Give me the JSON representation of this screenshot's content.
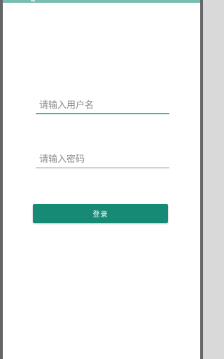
{
  "colors": {
    "status_bar": "#79bfb1",
    "accent": "#2ec4ad",
    "button": "#178a76",
    "underline_inactive": "#8a8a8a"
  },
  "form": {
    "username": {
      "placeholder": "请输入用户名",
      "value": ""
    },
    "password": {
      "placeholder": "请输入密码",
      "value": ""
    },
    "login_label": "登录"
  }
}
